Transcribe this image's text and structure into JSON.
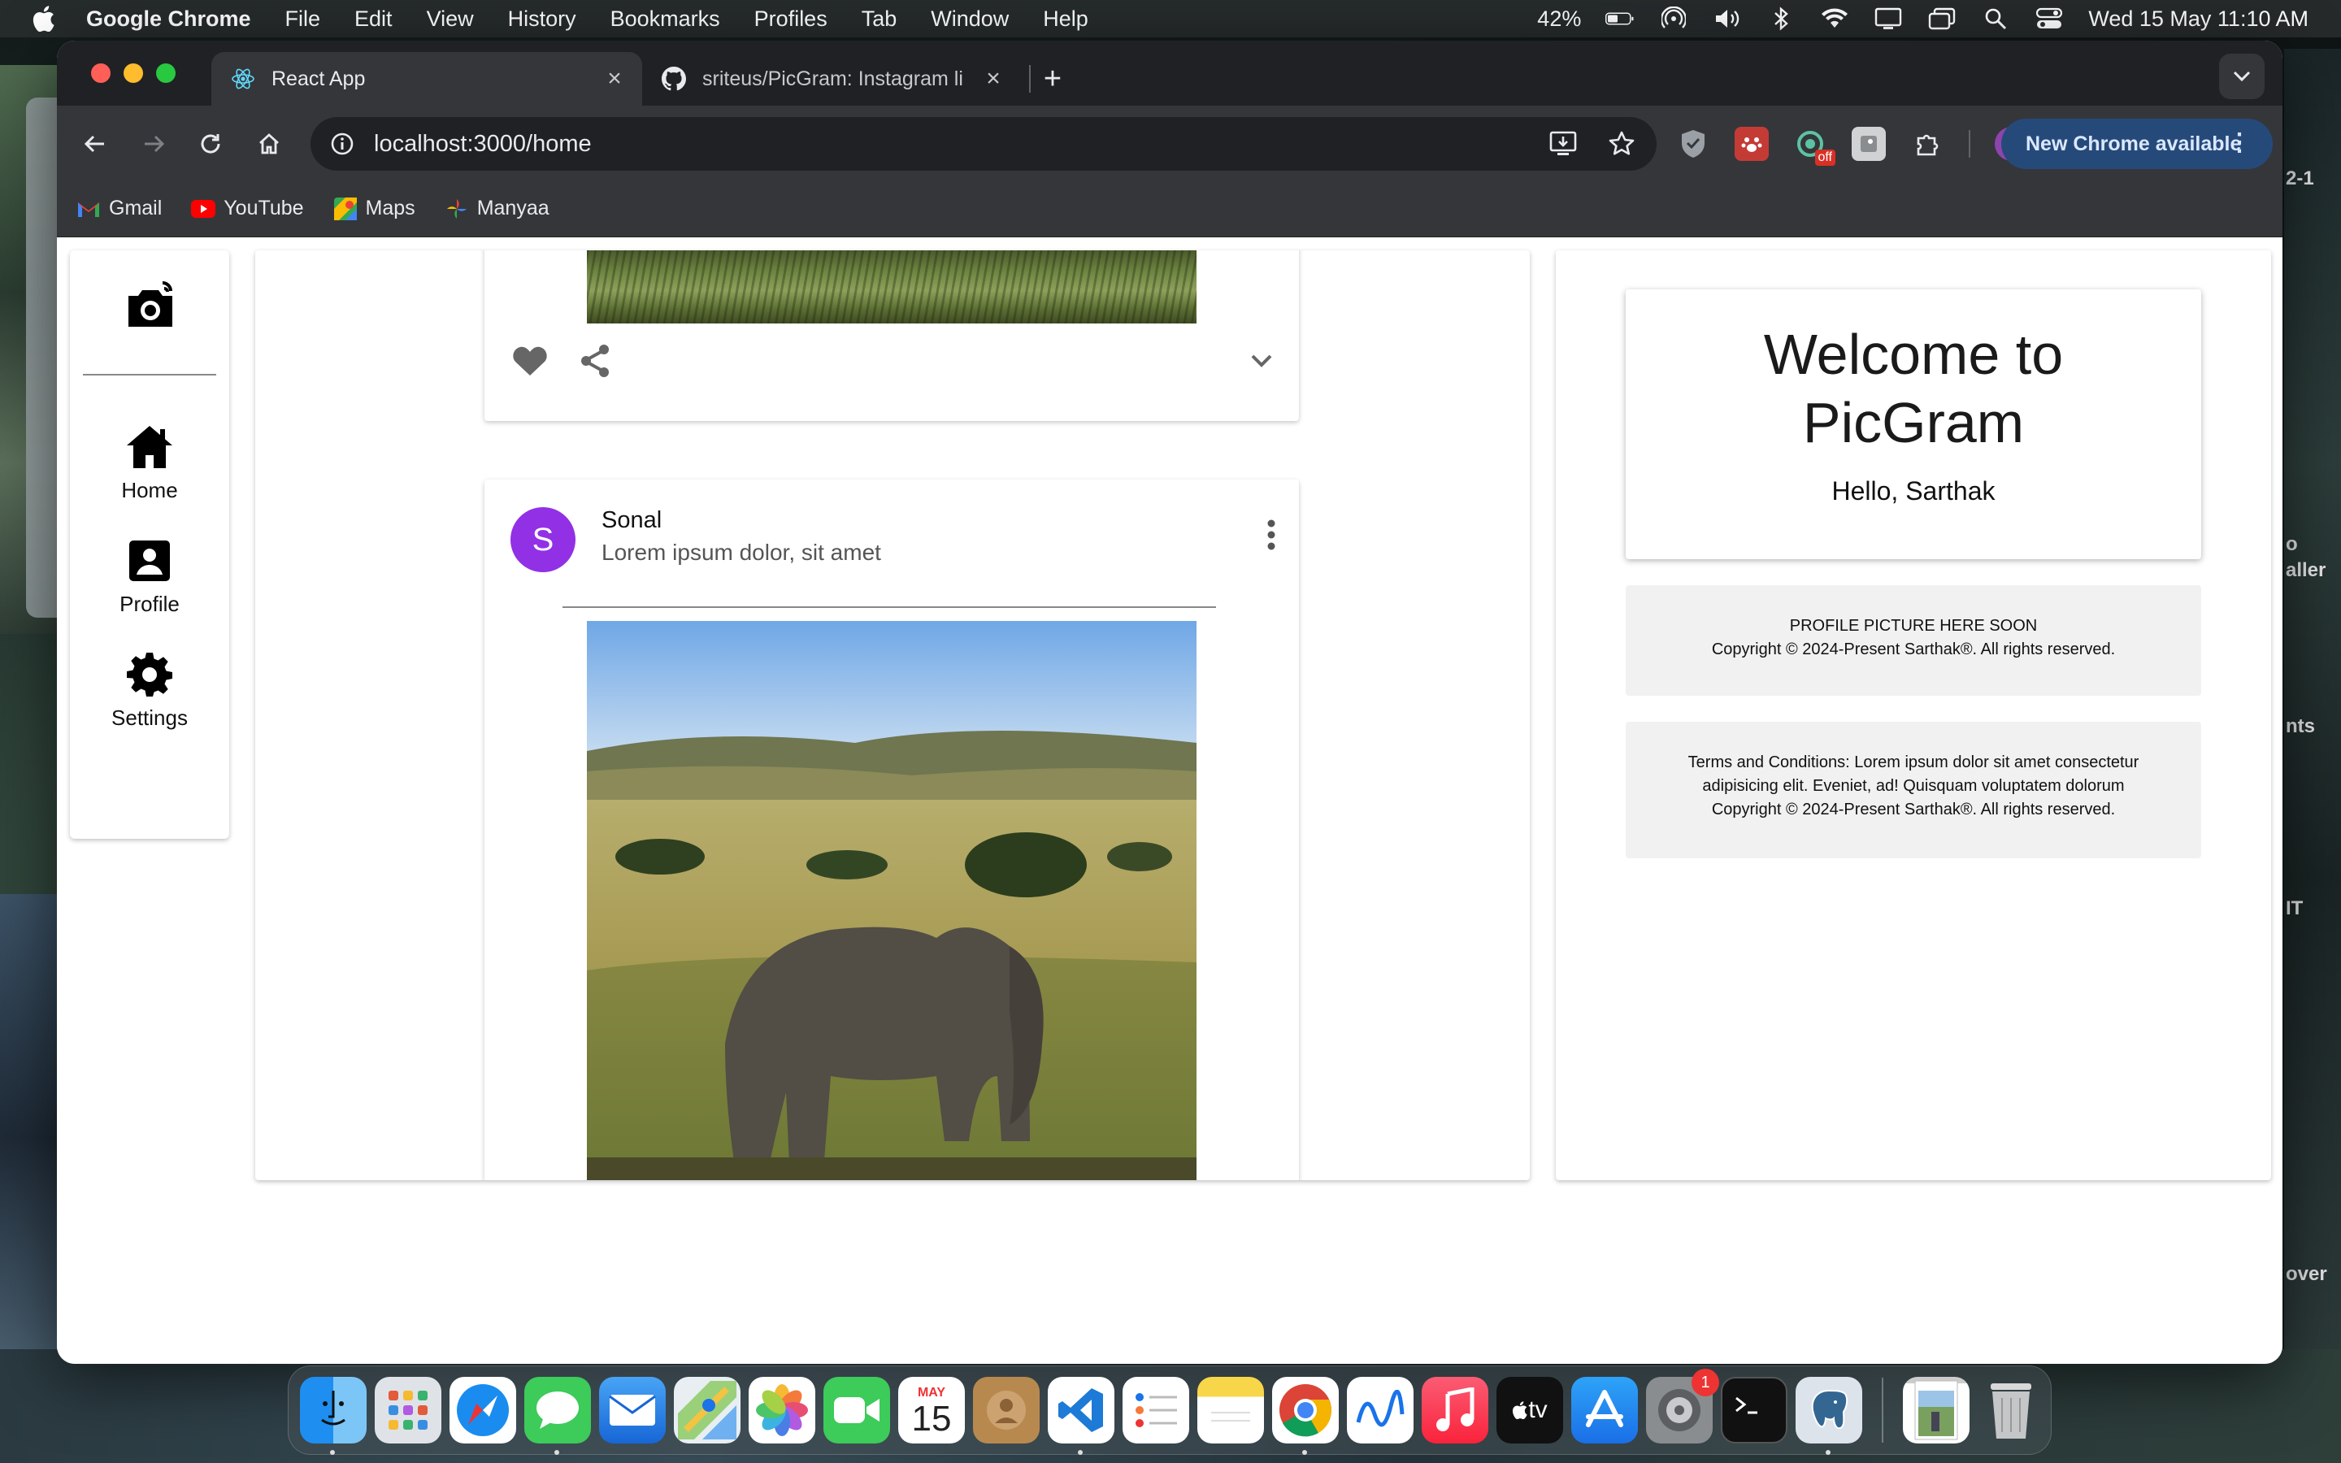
{
  "menubar": {
    "app_name": "Google Chrome",
    "items": [
      "File",
      "Edit",
      "View",
      "History",
      "Bookmarks",
      "Profiles",
      "Tab",
      "Window",
      "Help"
    ],
    "battery": "42%",
    "datetime": "Wed 15 May  11:10 AM"
  },
  "desktop_fragments": [
    "2-1",
    "o",
    "aller",
    "nts",
    "IT",
    "over"
  ],
  "browser": {
    "tabs": [
      {
        "title": "React App",
        "active": true,
        "icon": "react-icon"
      },
      {
        "title": "sriteus/PicGram: Instagram li",
        "active": false,
        "icon": "github-icon"
      }
    ],
    "url": "localhost:3000/home",
    "update_button": "New Chrome available",
    "ext_badge": "off",
    "bookmarks": [
      {
        "label": "Gmail",
        "icon": "gmail-icon"
      },
      {
        "label": "YouTube",
        "icon": "youtube-icon"
      },
      {
        "label": "Maps",
        "icon": "maps-icon"
      },
      {
        "label": "Manyaa",
        "icon": "photos-icon"
      }
    ]
  },
  "sidebar": {
    "items": [
      {
        "label": "Home",
        "icon": "home-icon"
      },
      {
        "label": "Profile",
        "icon": "profile-icon"
      },
      {
        "label": "Settings",
        "icon": "settings-icon"
      }
    ]
  },
  "posts": [
    {
      "author": "Sonal",
      "avatar_letter": "S",
      "avatar_color": "#9230e6",
      "subtitle": "Lorem ipsum dolor, sit amet"
    }
  ],
  "right_panel": {
    "welcome_line1": "Welcome to",
    "welcome_line2": "PicGram",
    "greeting": "Hello, Sarthak",
    "profile_note": "PROFILE PICTURE HERE SOON",
    "copyright": "Copyright © 2024-Present Sarthak®. All rights reserved.",
    "terms_line1": "Terms and Conditions: Lorem ipsum dolor sit amet consectetur",
    "terms_line2": "adipisicing elit. Eveniet, ad! Quisquam voluptatem dolorum",
    "terms_copyright": "Copyright © 2024-Present Sarthak®. All rights reserved."
  },
  "dock": {
    "calendar_month": "MAY",
    "calendar_day": "15",
    "settings_badge": "1",
    "tv_label": "tv"
  }
}
